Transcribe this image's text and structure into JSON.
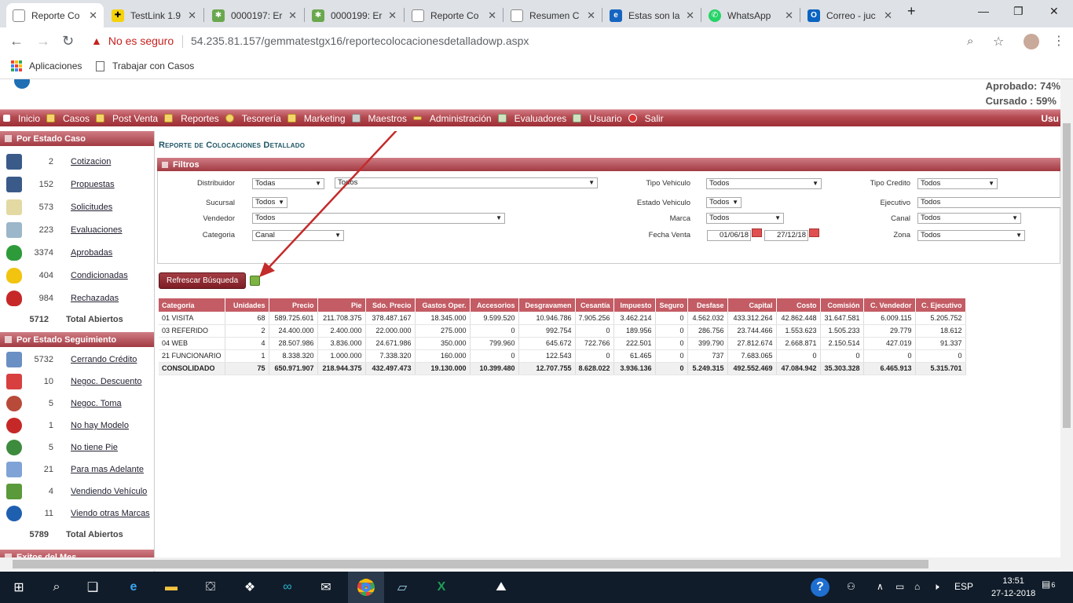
{
  "tabs": [
    {
      "title": "Reporte Co",
      "active": true
    },
    {
      "title": "TestLink 1.9"
    },
    {
      "title": "0000197: Er"
    },
    {
      "title": "0000199: Er"
    },
    {
      "title": "Reporte Co"
    },
    {
      "title": "Resumen C"
    },
    {
      "title": "Estas son la"
    },
    {
      "title": "WhatsApp"
    },
    {
      "title": "Correo - juc"
    }
  ],
  "tab_close": "✕",
  "new_tab": "+",
  "window_controls": {
    "minimize": "—",
    "maximize": "❐",
    "close": "✕"
  },
  "security_warning": "No es seguro",
  "url": "54.235.81.157/gemmatestgx16/reportecolocacionesdetalladowp.aspx",
  "bookmarks": {
    "apps": "Aplicaciones",
    "item1": "Trabajar con Casos"
  },
  "header": {
    "aprobado": "Aprobado: 74%",
    "cursado": "Cursado : 59%"
  },
  "nav": [
    "Inicio",
    "Casos",
    "Post Venta",
    "Reportes",
    "Tesorería",
    "Marketing",
    "Maestros",
    "Administración",
    "Evaluadores",
    "Usuario",
    "Salir"
  ],
  "nav_user": "Usu",
  "sidebar": {
    "estado_caso_title": "Por Estado Caso",
    "estado_caso": [
      {
        "count": "2",
        "label": "Cotizacion"
      },
      {
        "count": "152",
        "label": "Propuestas"
      },
      {
        "count": "573",
        "label": "Solicitudes"
      },
      {
        "count": "223",
        "label": "Evaluaciones"
      },
      {
        "count": "3374",
        "label": "Aprobadas"
      },
      {
        "count": "404",
        "label": "Condicionadas"
      },
      {
        "count": "984",
        "label": "Rechazadas"
      }
    ],
    "estado_caso_total": {
      "count": "5712",
      "label": "Total Abiertos"
    },
    "seguimiento_title": "Por Estado Seguimiento",
    "seguimiento": [
      {
        "count": "5732",
        "label": "Cerrando Crédito"
      },
      {
        "count": "10",
        "label": "Negoc. Descuento"
      },
      {
        "count": "5",
        "label": "Negoc. Toma"
      },
      {
        "count": "1",
        "label": "No hay Modelo"
      },
      {
        "count": "5",
        "label": "No tiene Pie"
      },
      {
        "count": "21",
        "label": "Para mas Adelante"
      },
      {
        "count": "4",
        "label": "Vendiendo Vehículo"
      },
      {
        "count": "11",
        "label": "Viendo otras Marcas"
      }
    ],
    "seguimiento_total": {
      "count": "5789",
      "label": "Total Abiertos"
    },
    "exitos_title": "Exitos del Mes"
  },
  "report_title": "Reporte de Colocaciones Detallado",
  "filters_title": "Filtros",
  "filters": {
    "distribuidor": {
      "label": "Distribuidor",
      "value": "Todas",
      "value2": "Todos"
    },
    "sucursal": {
      "label": "Sucursal",
      "value": "Todos"
    },
    "vendedor": {
      "label": "Vendedor",
      "value": "Todos"
    },
    "categoria": {
      "label": "Categoria",
      "value": "Canal"
    },
    "tipo_vehiculo": {
      "label": "Tipo Vehiculo",
      "value": "Todos"
    },
    "estado_vehiculo": {
      "label": "Estado Vehiculo",
      "value": "Todos"
    },
    "marca": {
      "label": "Marca",
      "value": "Todos"
    },
    "fecha_venta": {
      "label": "Fecha Venta",
      "from": "01/06/18",
      "to": "27/12/18"
    },
    "tipo_credito": {
      "label": "Tipo Credito",
      "value": "Todos"
    },
    "ejecutivo": {
      "label": "Ejecutivo",
      "value": "Todos"
    },
    "canal": {
      "label": "Canal",
      "value": "Todos"
    },
    "zona": {
      "label": "Zona",
      "value": "Todos"
    }
  },
  "refresh_label": "Refrescar Búsqueda",
  "table": {
    "headers": [
      "Categoría",
      "Unidades",
      "Precio",
      "Pie",
      "Sdo. Precio",
      "Gastos Oper.",
      "Accesorios",
      "Desgravamen",
      "Cesantía",
      "Impuesto",
      "Seguro",
      "Desfase",
      "Capital",
      "Costo",
      "Comisión",
      "C. Vendedor",
      "C. Ejecutivo"
    ],
    "rows": [
      [
        "01 VISITA",
        "68",
        "589.725.601",
        "211.708.375",
        "378.487.167",
        "18.345.000",
        "9.599.520",
        "10.946.786",
        "7.905.256",
        "3.462.214",
        "0",
        "4.562.032",
        "433.312.264",
        "42.862.448",
        "31.647.581",
        "6.009.115",
        "5.205.752"
      ],
      [
        "03 REFERIDO",
        "2",
        "24.400.000",
        "2.400.000",
        "22.000.000",
        "275.000",
        "0",
        "992.754",
        "0",
        "189.956",
        "0",
        "286.756",
        "23.744.466",
        "1.553.623",
        "1.505.233",
        "29.779",
        "18.612"
      ],
      [
        "04 WEB",
        "4",
        "28.507.986",
        "3.836.000",
        "24.671.986",
        "350.000",
        "799.960",
        "645.672",
        "722.766",
        "222.501",
        "0",
        "399.790",
        "27.812.674",
        "2.668.871",
        "2.150.514",
        "427.019",
        "91.337"
      ],
      [
        "21 FUNCIONARIO",
        "1",
        "8.338.320",
        "1.000.000",
        "7.338.320",
        "160.000",
        "0",
        "122.543",
        "0",
        "61.465",
        "0",
        "737",
        "7.683.065",
        "0",
        "0",
        "0",
        "0"
      ]
    ],
    "total": [
      "CONSOLIDADO",
      "75",
      "650.971.907",
      "218.944.375",
      "432.497.473",
      "19.130.000",
      "10.399.480",
      "12.707.755",
      "8.628.022",
      "3.936.136",
      "0",
      "5.249.315",
      "492.552.469",
      "47.084.942",
      "35.303.328",
      "6.465.913",
      "5.315.701"
    ]
  },
  "taskbar": {
    "lang": "ESP",
    "time": "13:51",
    "date": "27-12-2018",
    "notifications": "6"
  }
}
